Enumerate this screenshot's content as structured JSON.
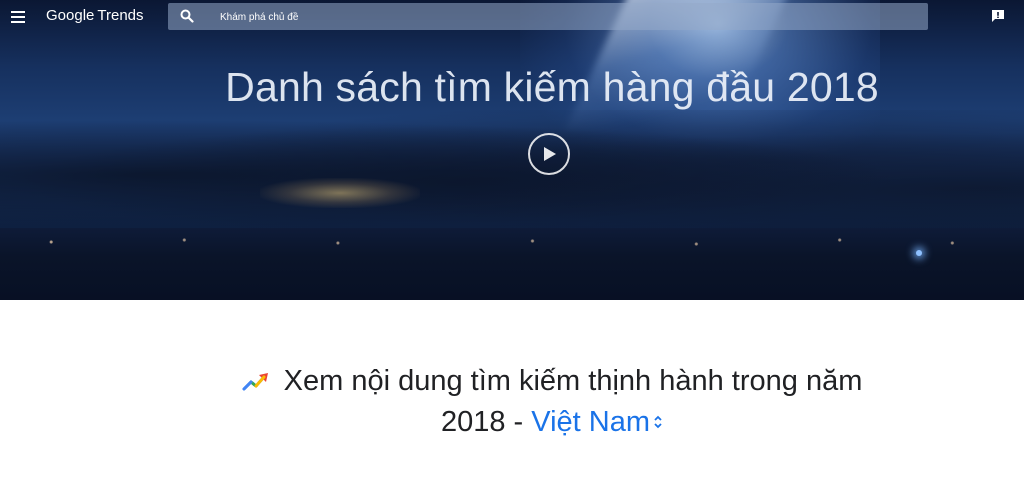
{
  "app": {
    "logo_primary": "Google",
    "logo_secondary": "Trends"
  },
  "search": {
    "placeholder": "Khám phá chủ đề"
  },
  "hero": {
    "title": "Danh sách tìm kiếm hàng đầu 2018"
  },
  "section": {
    "heading_line1": "Xem nội dung tìm kiếm thịnh hành trong năm",
    "heading_year": "2018",
    "heading_separator": " - ",
    "country": "Việt Nam"
  },
  "icons": [
    "menu-icon",
    "search-icon",
    "feedback-icon",
    "play-icon",
    "trending-up-icon",
    "unfold-icon"
  ],
  "colors": {
    "accent": "#1a73e8",
    "text": "#202124",
    "hero_dark": "#0b1733"
  }
}
